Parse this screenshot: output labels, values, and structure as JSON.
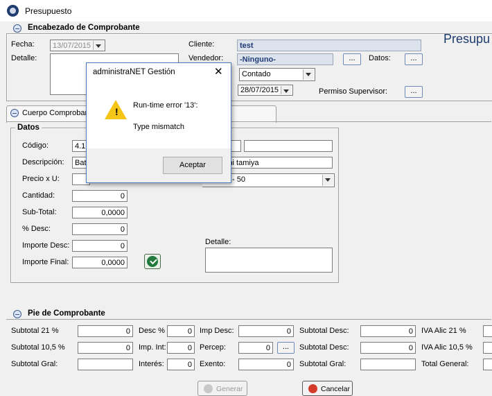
{
  "window": {
    "title": "Presupuesto"
  },
  "header": {
    "section_title": "Encabezado de Comprobante",
    "fecha_label": "Fecha:",
    "fecha_value": "13/07/2015",
    "detalle_label": "Detalle:",
    "cliente_label": "Cliente:",
    "cliente_value": "test",
    "vendedor_label": "Vendedor:",
    "vendedor_value": "-Ninguno-",
    "datos_label": "Datos:",
    "forma_pago_value": "Contado",
    "vencimiento_value": "28/07/2015",
    "permiso_label": "Permiso Supervisor:",
    "dots": "...",
    "big_title": "Presupu"
  },
  "body_tab": {
    "label": "Cuerpo Comproban"
  },
  "datos": {
    "section_title": "Datos",
    "codigo_label": "Código:",
    "codigo_value": "4.1.",
    "descripcion_label": "Descripción:",
    "descripcion_value": "Batt",
    "descripcion_right_value": "ini tamiya",
    "precio_label": "Precio x U:",
    "lista_value": "- 50",
    "cantidad_label": "Cantidad:",
    "cantidad_value": "0",
    "subtotal_label": "Sub-Total:",
    "subtotal_value": "0,0000",
    "desc_label": "% Desc:",
    "desc_value": "0",
    "importe_desc_label": "Importe Desc:",
    "importe_desc_value": "0",
    "importe_final_label": "Importe Final:",
    "importe_final_value": "0,0000",
    "detalle_label": "Detalle:"
  },
  "footer": {
    "section_title": "Pie de Comprobante",
    "subtotal21_label": "Subtotal  21 %",
    "subtotal21_value": "0",
    "subtotal105_label": "Subtotal  10,5 %",
    "subtotal105_value": "0",
    "subtotal_gral_label": "Subtotal Gral:",
    "desc_pct_label": "Desc %",
    "desc_pct_value": "0",
    "imp_int_label": "Imp. Int:",
    "imp_int_value": "0",
    "interes_label": "Interés:",
    "interes_value": "0",
    "imp_desc_label": "Imp Desc:",
    "imp_desc_value": "0",
    "percep_label": "Percep:",
    "percep_value": "0",
    "exento_label": "Exento:",
    "exento_value": "0",
    "sub_desc1_label": "Subtotal Desc:",
    "sub_desc1_value": "0",
    "sub_desc2_label": "Subtotal Desc:",
    "sub_desc2_value": "0",
    "sub_gral2_label": "Subtotal Gral:",
    "iva21_label": "IVA Alic   21 %",
    "iva105_label": "IVA Alic  10,5 %",
    "total_gral_label": "Total General:",
    "generar_label": "Generar",
    "cancelar_label": "Cancelar"
  },
  "dialog": {
    "title": "administraNET Gestión",
    "close": "✕",
    "message_line1": "Run-time error '13':",
    "message_line2": "Type mismatch",
    "accept_label": "Aceptar"
  }
}
